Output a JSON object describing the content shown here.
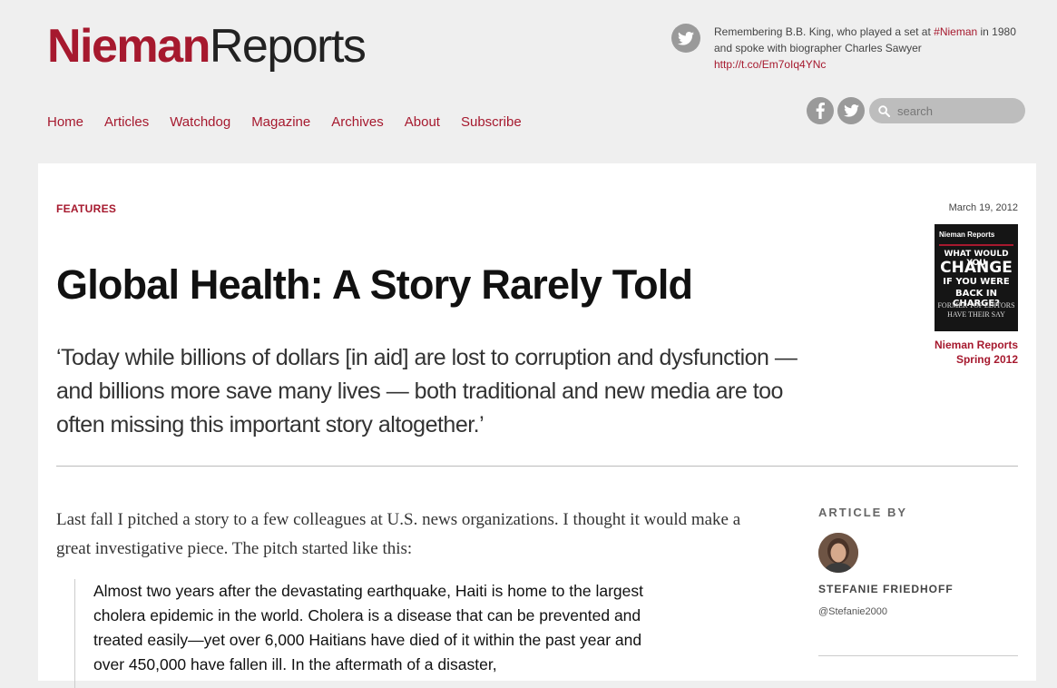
{
  "header": {
    "logo_part1": "Nieman",
    "logo_part2": "Reports",
    "nav": [
      "Home",
      "Articles",
      "Watchdog",
      "Magazine",
      "Archives",
      "About",
      "Subscribe"
    ],
    "tweet": {
      "text1": "Remembering B.B. King, who played a set at ",
      "hashtag": "#Nieman",
      "text2": " in 1980 and spoke with biographer Charles Sawyer ",
      "link": "http://t.co/Em7oIq4YNc"
    },
    "search_placeholder": "search"
  },
  "article": {
    "category": "FEATURES",
    "date": "March 19, 2012",
    "title": "Global Health: A Story Rarely Told",
    "dek": "‘Today while billions of dollars [in aid] are lost to corruption and dysfunction — and billions more save many lives — both traditional and new media are too often missing this important story altogether.’",
    "body": "Last fall I pitched a story to a few colleagues at U.S. news organizations. I thought it would make a great investigative piece. The pitch started like this:",
    "quote": "Almost two years after the devastating earthquake, Haiti is home to the largest cholera epidemic in the world. Cholera is a disease that can be prevented and treated easily—yet over 6,000 Haitians have died of it within the past year and over 450,000 have fallen ill. In the aftermath of a disaster,"
  },
  "cover": {
    "brand": "Nieman Reports",
    "line1": "WHAT WOULD YOU",
    "line2": "CHANGE",
    "line3": "IF YOU WERE",
    "line4": "BACK IN CHARGE?",
    "line5": "FORMER TOP EDITORS",
    "line6": "HAVE THEIR SAY",
    "caption1": "Nieman Reports",
    "caption2": "Spring 2012"
  },
  "sidebar": {
    "label": "ARTICLE BY",
    "author": "STEFANIE FRIEDHOFF",
    "handle": "@Stefanie2000"
  },
  "colors": {
    "brand": "#a6192e",
    "icon_grey": "#9a9a9a"
  }
}
